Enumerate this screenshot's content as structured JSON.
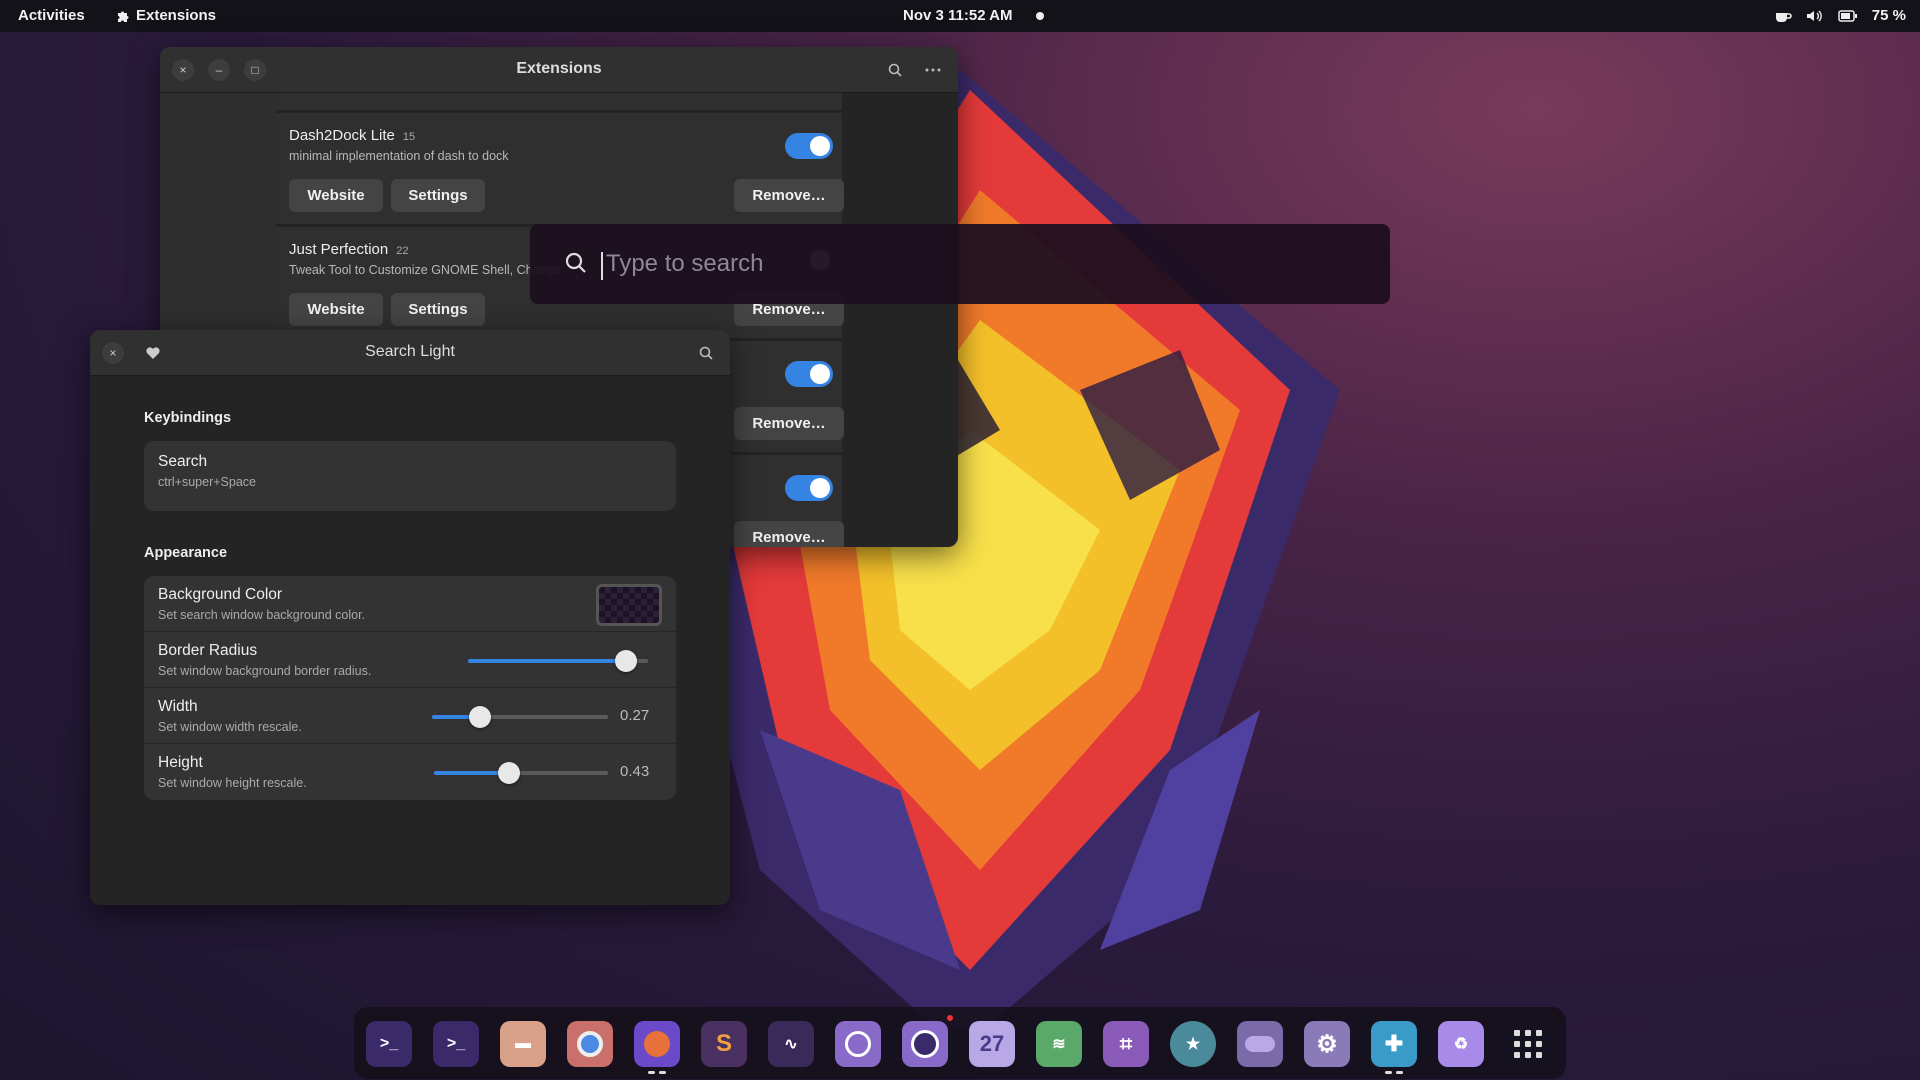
{
  "topbar": {
    "activities": "Activities",
    "app_name": "Extensions",
    "clock": "Nov 3  11:52 AM",
    "battery": "75 %"
  },
  "extensions_window": {
    "title": "Extensions",
    "buttons": {
      "close": "×",
      "minimize": "–",
      "maximize": "□"
    },
    "cards": [
      {
        "name": "Dash2Dock Lite",
        "version": "15",
        "description": "minimal implementation of dash to dock",
        "enabled": true,
        "website": "Website",
        "settings": "Settings",
        "remove": "Remove…"
      },
      {
        "name": "Just Perfection",
        "version": "22",
        "description": "Tweak Tool to Customize GNOME Shell, Change",
        "enabled": true,
        "website": "Website",
        "settings": "Settings",
        "remove": "Remove…"
      },
      {
        "remove": "Remove…",
        "enabled": true
      },
      {
        "remove": "Remove…",
        "enabled": true
      }
    ]
  },
  "search_popup": {
    "placeholder": "Type to search"
  },
  "prefs_window": {
    "title": "Search Light",
    "keybindings_label": "Keybindings",
    "search_title": "Search",
    "search_shortcut": "ctrl+super+Space",
    "appearance_label": "Appearance",
    "rows": {
      "bg_title": "Background Color",
      "bg_sub": "Set search window background color.",
      "radius_title": "Border Radius",
      "radius_sub": "Set window background border radius.",
      "radius_value": 0.88,
      "width_title": "Width",
      "width_sub": "Set window width rescale.",
      "width_value": "0.27",
      "width_level": 0.27,
      "height_title": "Height",
      "height_sub": "Set window height rescale.",
      "height_value": "0.43",
      "height_level": 0.43
    }
  },
  "dock": {
    "items": [
      "terminal",
      "terminal-2",
      "files",
      "chromium",
      "firefox",
      "sublime-text",
      "inkscape",
      "screenshot",
      "clocks",
      "calendar",
      "spotify",
      "crop-tool",
      "starbucks",
      "toggle-app",
      "settings",
      "extensions",
      "trash",
      "app-grid"
    ],
    "calendar_day": "27",
    "colors": {
      "accent": "#3584e4",
      "dock_icon": "#7c5ab8"
    }
  }
}
